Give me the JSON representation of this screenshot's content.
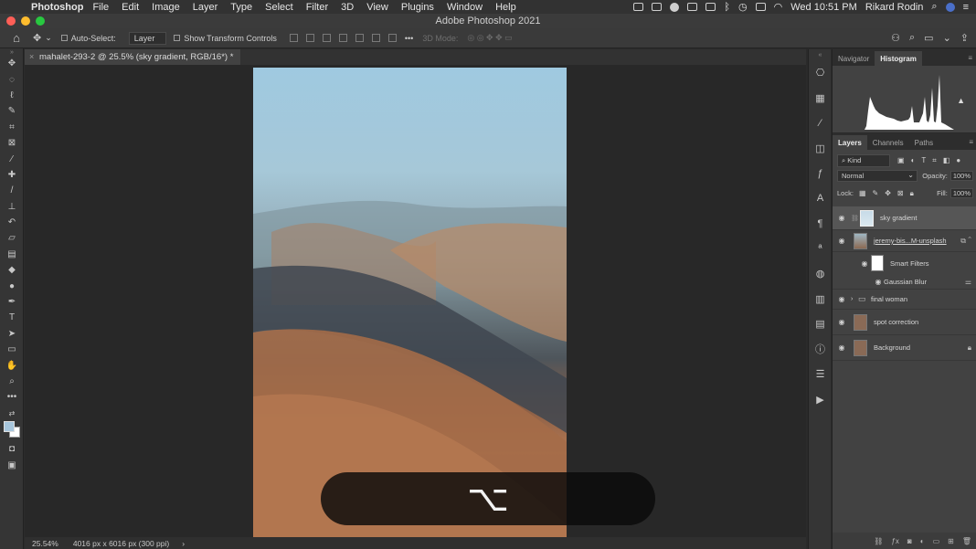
{
  "menubar": {
    "app": "Photoshop",
    "items": [
      "File",
      "Edit",
      "Image",
      "Layer",
      "Type",
      "Select",
      "Filter",
      "3D",
      "View",
      "Plugins",
      "Window",
      "Help"
    ],
    "clock": "Wed 10:51 PM",
    "user": "Rikard Rodin"
  },
  "window": {
    "title": "Adobe Photoshop 2021"
  },
  "options": {
    "auto_select_label": "Auto-Select:",
    "auto_select_value": "Layer",
    "transform_label": "Show Transform Controls",
    "mode_3d": "3D Mode:"
  },
  "document": {
    "tab_title": "mahalet-293-2 @ 25.5% (sky gradient, RGB/16*) *",
    "close": "×"
  },
  "status": {
    "zoom": "25.54%",
    "dimensions": "4016 px x 6016 px (300 ppi)",
    "arrow": "›"
  },
  "keystroke": {
    "symbol": "⌥"
  },
  "panels": {
    "top_tabs": [
      "Navigator",
      "Histogram"
    ],
    "top_active": "Histogram",
    "layer_tabs": [
      "Layers",
      "Channels",
      "Paths"
    ],
    "layer_active": "Layers",
    "filter_kind": "Kind",
    "blend_mode": "Normal",
    "opacity_label": "Opacity:",
    "opacity_value": "100%",
    "lock_label": "Lock:",
    "fill_label": "Fill:",
    "fill_value": "100%"
  },
  "layers": [
    {
      "name": "sky gradient",
      "selected": true
    },
    {
      "name": "jeremy-bis...M-unsplash",
      "selected": false
    },
    {
      "name": "Smart Filters",
      "selected": false
    },
    {
      "name": "Gaussian Blur",
      "selected": false
    },
    {
      "name": "final woman",
      "selected": false
    },
    {
      "name": "spot correction",
      "selected": false
    },
    {
      "name": "Background",
      "selected": false
    }
  ],
  "colors": {
    "accent_close": "#ff5f57",
    "accent_min": "#febc2e",
    "accent_max": "#28c840",
    "foreground_swatch": "#a7c6dc",
    "background_swatch": "#ffffff"
  }
}
